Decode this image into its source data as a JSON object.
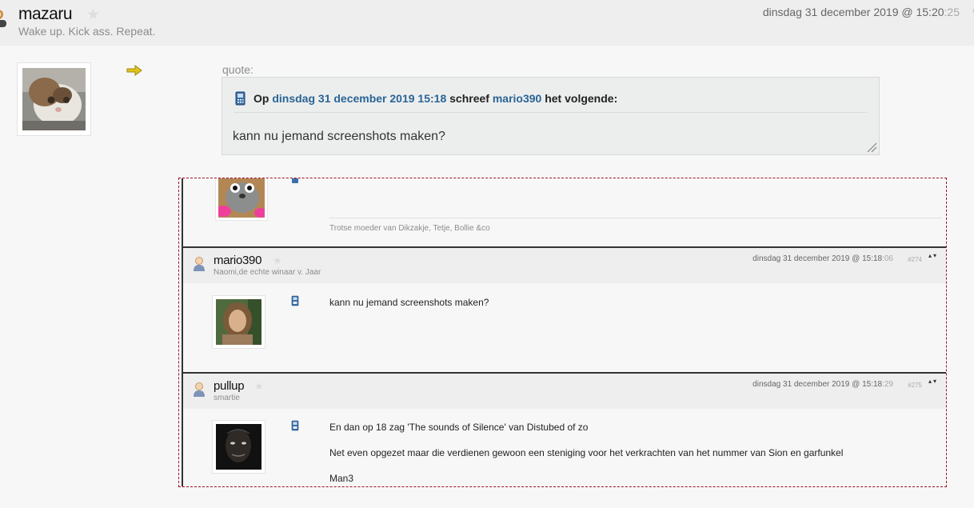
{
  "post": {
    "username": "mazaru",
    "tagline": "Wake up. Kick ass. Repeat.",
    "date": "dinsdag 31 december 2019 @ 15:20",
    "date_seconds": ":25",
    "post_number": "#"
  },
  "quote": {
    "label": "quote:",
    "prefix": "Op",
    "date_link": "dinsdag 31 december 2019 15:18",
    "mid": "schreef",
    "author_link": "mario390",
    "suffix": "het volgende:",
    "text": "kann nu jemand screenshots maken?"
  },
  "embedded": {
    "top_signature": "Trotse moeder van Dikzakje, Tetje, Bollie &co",
    "posts": [
      {
        "username": "mario390",
        "tagline": "Naomi,de echte winaar v. Jaar",
        "date": "dinsdag 31 december 2019 @ 15:18",
        "date_seconds": ":06",
        "number": "#274",
        "arrows": "▴▾",
        "lines": [
          "kann nu jemand screenshots maken?"
        ]
      },
      {
        "username": "pullup",
        "tagline": "smartie",
        "date": "dinsdag 31 december 2019 @ 15:18",
        "date_seconds": ":29",
        "number": "#275",
        "arrows": "▴▾",
        "lines": [
          "En dan op 18 zag 'The sounds of Silence' van Distubed of zo",
          "Net even opgezet maar die verdienen gewoon een steniging voor het verkrachten van het nummer van Sion en garfunkel",
          "Man3"
        ]
      }
    ]
  },
  "icons": {
    "user": "user-icon",
    "star": "star-icon",
    "arrow": "arrow-right-icon",
    "phone": "mobile-phone-icon",
    "resize": "resize-grip-icon",
    "sort": "sort-arrows-icon"
  },
  "colors": {
    "link": "#2a6496",
    "header_bg": "#eeeeee",
    "frame": "#a0132a"
  }
}
